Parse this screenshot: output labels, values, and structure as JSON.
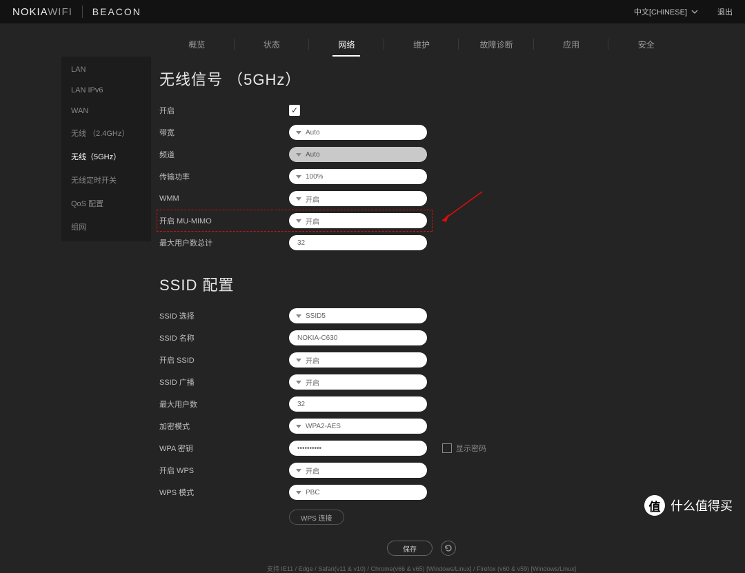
{
  "header": {
    "brand_prefix": "NOKIA",
    "brand_suffix": "WIFI",
    "product": "BEACON",
    "language": "中文[CHINESE]",
    "logout": "退出"
  },
  "tabs": [
    "概览",
    "状态",
    "网络",
    "维护",
    "故障诊断",
    "应用",
    "安全"
  ],
  "active_tab": 2,
  "sidebar": [
    "LAN",
    "LAN IPv6",
    "WAN",
    "无线 （2.4GHz）",
    "无线（5GHz）",
    "无线定时开关",
    "QoS 配置",
    "组网"
  ],
  "active_side": 4,
  "section_a": {
    "title": "无线信号 （5GHz）",
    "rows": {
      "enable": {
        "label": "开启",
        "checked": true
      },
      "bandwidth": {
        "label": "带宽",
        "value": "Auto"
      },
      "channel": {
        "label": "频道",
        "value": "Auto",
        "disabled": true
      },
      "txpower": {
        "label": "传输功率",
        "value": "100%"
      },
      "wmm": {
        "label": "WMM",
        "value": "开启"
      },
      "mumimo": {
        "label": "开启 MU-MIMO",
        "value": "开启",
        "highlight": true
      },
      "maxusers": {
        "label": "最大用户数总计",
        "value": "32"
      }
    }
  },
  "section_b": {
    "title": "SSID 配置",
    "rows": {
      "ssidselect": {
        "label": "SSID 选择",
        "value": "SSID5"
      },
      "ssidname": {
        "label": "SSID 名称",
        "value": "NOKIA-C630"
      },
      "ssidenable": {
        "label": "开启 SSID",
        "value": "开启"
      },
      "broadcast": {
        "label": "SSID 广播",
        "value": "开启"
      },
      "maxusers": {
        "label": "最大用户数",
        "value": "32"
      },
      "enc": {
        "label": "加密模式",
        "value": "WPA2-AES"
      },
      "wpakey": {
        "label": "WPA 密钥",
        "value": "••••••••••"
      },
      "showpwd": "显示密码",
      "wpsenable": {
        "label": "开启 WPS",
        "value": "开启"
      },
      "wpsmode": {
        "label": "WPS 模式",
        "value": "PBC"
      },
      "wpslink": "WPS 连接"
    }
  },
  "buttons": {
    "save": "保存"
  },
  "footer": "支持 IE11 / Edge / Safari(v11 & v10) / Chrome(v66 & v65) [Windows/Linux] / Firefox (v60 & v59) [Windows/Linux]",
  "watermark": {
    "badge": "值",
    "text": "什么值得买"
  }
}
